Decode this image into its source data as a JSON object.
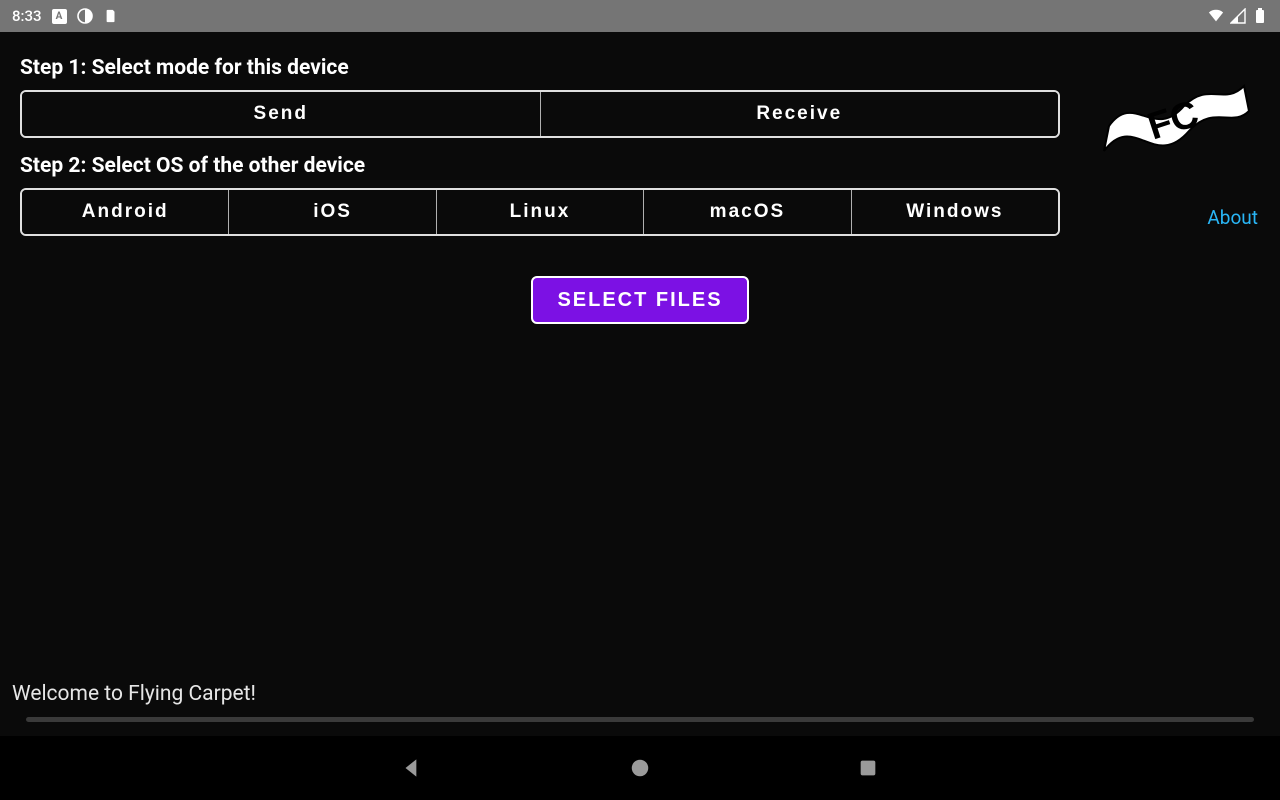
{
  "status": {
    "time": "8:33"
  },
  "steps": {
    "step1_label": "Step 1: Select mode for this device",
    "step2_label": "Step 2: Select OS of the other device",
    "mode_options": [
      "Send",
      "Receive"
    ],
    "os_options": [
      "Android",
      "iOS",
      "Linux",
      "macOS",
      "Windows"
    ]
  },
  "actions": {
    "select_files_label": "SELECT FILES",
    "about_label": "About"
  },
  "footer": {
    "welcome": "Welcome to Flying Carpet!"
  },
  "colors": {
    "accent": "#7c11e4",
    "link": "#29b6f6"
  }
}
